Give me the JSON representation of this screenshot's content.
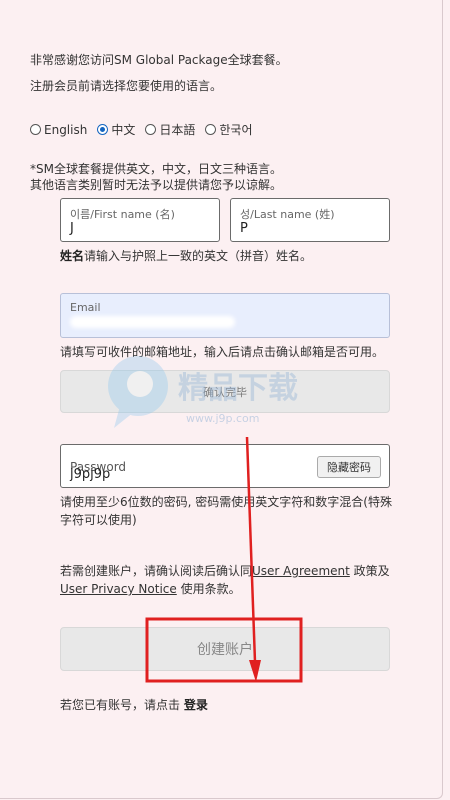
{
  "intro": {
    "line1": "非常感谢您访问SM Global Package全球套餐。",
    "line2": "注册会员前请选择您要使用的语言。"
  },
  "languages": [
    {
      "label": "English",
      "selected": false
    },
    {
      "label": "中文",
      "selected": true
    },
    {
      "label": "日本語",
      "selected": false
    },
    {
      "label": "한국어",
      "selected": false
    }
  ],
  "language_note": {
    "line1": "*SM全球套餐提供英文，中文，日文三种语言。",
    "line2": "其他语言类别暂时无法予以提供请您予以谅解。"
  },
  "first_name": {
    "label": "이름/First name (名)",
    "value": "J"
  },
  "last_name": {
    "label": "성/Last name (姓)",
    "value": "P"
  },
  "name_hint": {
    "bold": "姓名",
    "text": "请输入与护照上一致的英文（拼音）姓名。"
  },
  "email": {
    "label": "Email"
  },
  "email_hint": "请填写可收件的邮箱地址，输入后请点击确认邮箱是否可用。",
  "confirm_button": "确认完毕",
  "password": {
    "label": "Password",
    "value": "j9pj9p",
    "toggle_label": "隐藏密码"
  },
  "password_hint": {
    "line1": "请使用至少6位数的密码, 密码需使用英文字符和数字混合(特殊",
    "line2": "字符可以使用)"
  },
  "agreement": {
    "pre": "若需创建账户，请确认阅读后确认同",
    "link1": "User Agreement",
    "mid": "政策及",
    "link2": "User Privacy Notice",
    "post": "使用条款。"
  },
  "create_button": "创建账户",
  "login_prompt": {
    "text": "若您已有账号，请点击 ",
    "link": "登录"
  },
  "watermark": {
    "title": "精品下载",
    "url": "www.j9p.com"
  },
  "colors": {
    "background": "#fcf0f2",
    "annotation": "#e02020",
    "radio_selected": "#1565c0"
  }
}
